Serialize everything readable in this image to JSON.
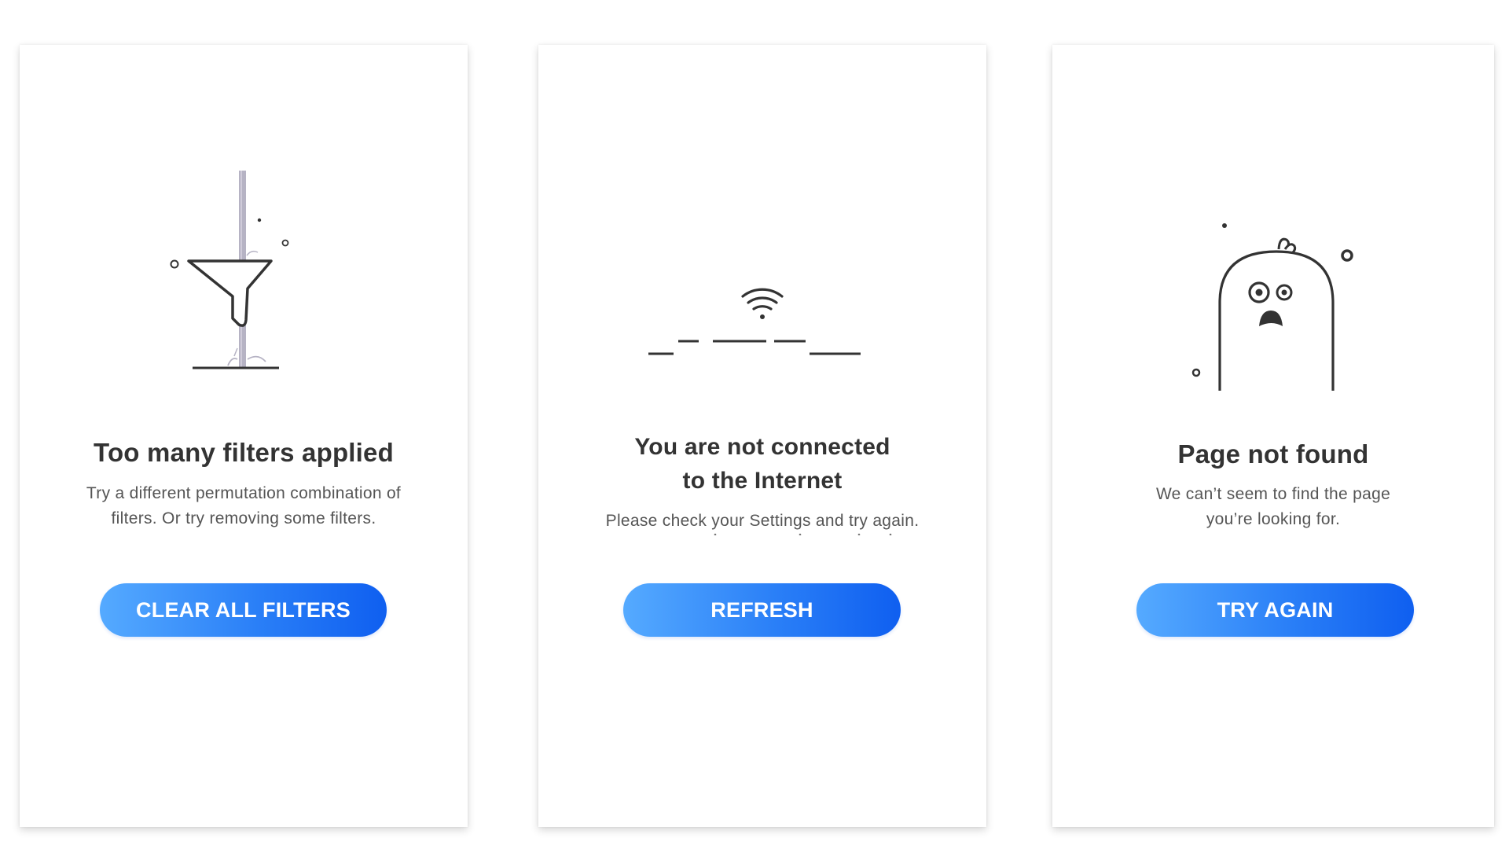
{
  "cards": [
    {
      "illustration": "funnel-icon",
      "title": "Too many filters applied",
      "description": [
        "Try a different permutation combination of",
        "filters. Or try removing some filters."
      ],
      "button_label": "CLEAR ALL FILTERS"
    },
    {
      "illustration": "wifi-icon",
      "title": [
        "You are not connected",
        "to the Internet"
      ],
      "description": [
        "Please check your Settings and try again."
      ],
      "button_label": "REFRESH"
    },
    {
      "illustration": "ghost-icon",
      "title": "Page not found",
      "description": [
        "We can’t seem to find the page",
        "you’re looking for."
      ],
      "button_label": "TRY AGAIN"
    }
  ],
  "colors": {
    "button_gradient_start": "#55aaff",
    "button_gradient_end": "#0f5ff0",
    "title_text": "#333333",
    "body_text": "#555555",
    "illustration_stroke": "#333333",
    "funnel_pole": "#b6b3c4"
  }
}
